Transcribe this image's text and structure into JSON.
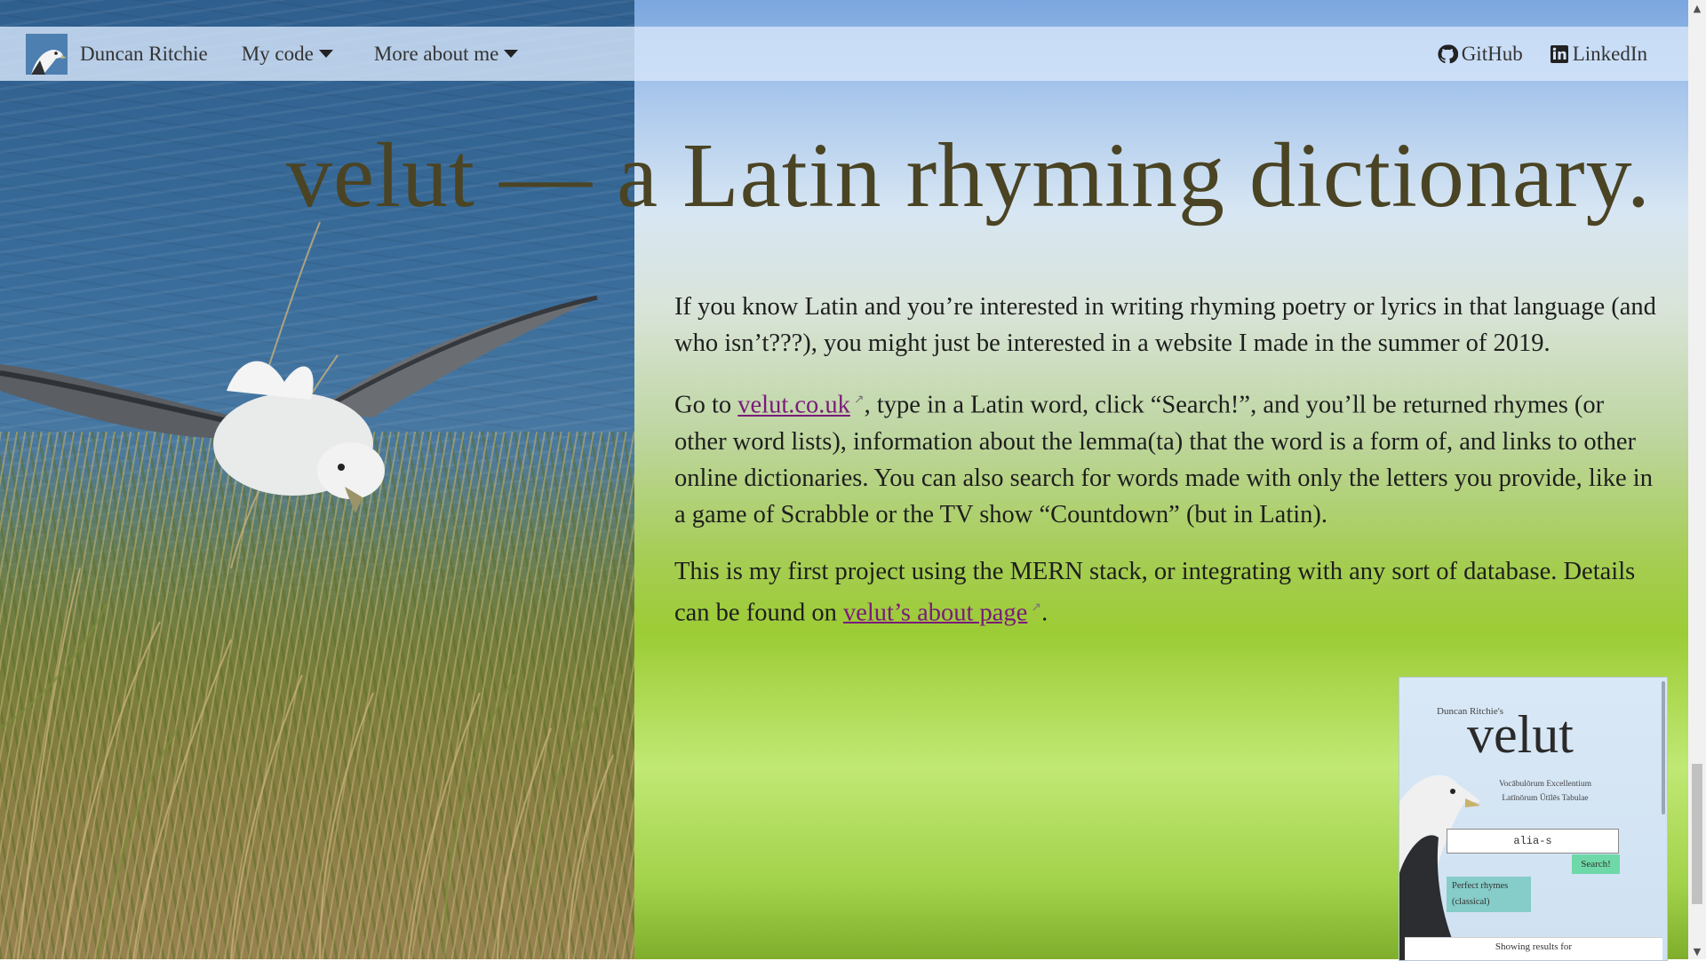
{
  "navbar": {
    "brand_name": "Duncan Ritchie",
    "my_code": "My code",
    "more_about_me": "More about me",
    "github": "GitHub",
    "linkedin": "LinkedIn",
    "logo_icon": "fulmar-logo-icon"
  },
  "heading": "velut — a Latin rhyming dictionary.",
  "body": {
    "p1": "If you know Latin and you’re interested in writing rhyming poetry or lyrics in that language (and who isn’t???), you might just be interested in a website I made in the summer of 2019.",
    "p2_pre": "Go to ",
    "p2_link": "velut.co.uk",
    "p2_post": ", type in a Latin word, click “Search!”, and you’ll be returned rhymes (or other word lists), information about the lemma(ta) that the word is a form of, and links to other online dictionaries. You can also search for words made with only the letters you provide, like in a game of Scrabble or the TV show “Countdown” (but in Latin).",
    "p3_pre": "This is my first project using the MERN stack, or integrating with any sort of database. Details can be found on ",
    "p3_link": "velut’s about page",
    "p3_post": ".",
    "external_icon": "↗"
  },
  "thumbnail": {
    "pre_title": "Duncan Ritchie's",
    "title": "velut",
    "subtitle_1": "Vocābulōrum Excellentium",
    "subtitle_2": "Latīnōrum Ūtīlēs Tabulae",
    "search_value": "alia-s",
    "search_button": "Search!",
    "perfect_rhymes_1": "Perfect rhymes",
    "perfect_rhymes_2": "(classical)",
    "results_text": "Showing results for"
  },
  "colors": {
    "heading": "#4a4424",
    "link": "#7a1a7a",
    "navbar_bg": "#d6e5fa"
  }
}
